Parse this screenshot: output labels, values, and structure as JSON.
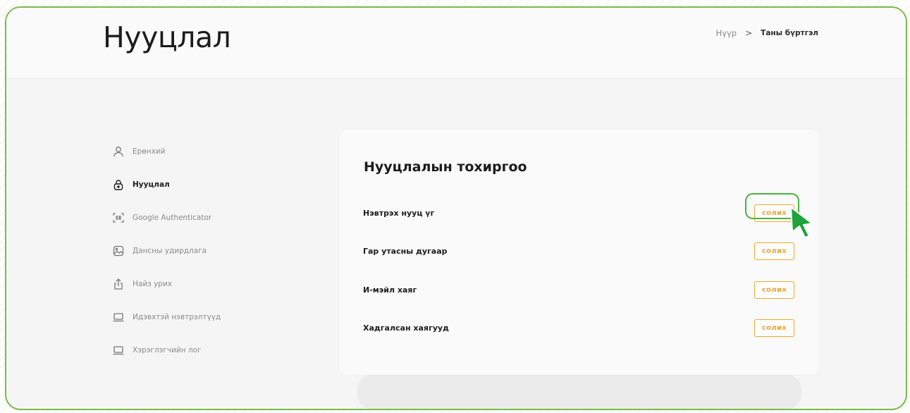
{
  "header": {
    "title": "Нууцлал",
    "breadcrumb": {
      "home": "Нүүр",
      "separator": ">",
      "current": "Таны бүртгэл"
    }
  },
  "sidebar": {
    "items": [
      {
        "label": "Ерөнхий",
        "icon": "user-icon",
        "active": false
      },
      {
        "label": "Нууцлал",
        "icon": "lock-icon",
        "active": true
      },
      {
        "label": "Google Authenticator",
        "icon": "barcode-scan-icon",
        "active": false
      },
      {
        "label": "Дансны удирдлага",
        "icon": "image-icon",
        "active": false
      },
      {
        "label": "Найз урих",
        "icon": "share-icon",
        "active": false
      },
      {
        "label": "Идэвхтэй нэвтрэлтүүд",
        "icon": "laptop-icon",
        "active": false
      },
      {
        "label": "Хэрэглэгчийн лог",
        "icon": "laptop-icon",
        "active": false
      }
    ]
  },
  "security": {
    "title": "Нууцлалын тохиргоо",
    "rows": [
      {
        "label": "Нэвтрэх нууц үг",
        "button": "солих"
      },
      {
        "label": "Гар утасны дугаар",
        "button": "солих"
      },
      {
        "label": "И-мэйл хаяг",
        "button": "солих"
      },
      {
        "label": "Хадгалсан хаягууд",
        "button": "солих"
      }
    ]
  },
  "colors": {
    "accent_orange": "#f0a430",
    "frame_green": "#7cb94a",
    "highlight_green": "#48b23f",
    "cursor_green": "#1fa33a"
  }
}
